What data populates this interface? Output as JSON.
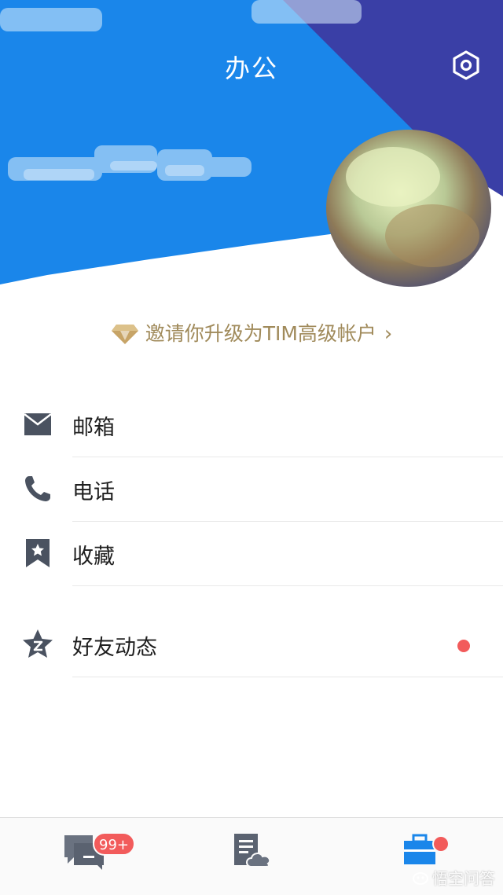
{
  "header": {
    "title": "办公",
    "settings_icon": "settings-hexagon-icon"
  },
  "invite": {
    "text": "邀请你升级为TIM高级帐户",
    "chevron": "›",
    "color": "#a08a5a"
  },
  "menu": [
    {
      "label": "邮箱",
      "icon": "mail-icon"
    },
    {
      "label": "电话",
      "icon": "phone-icon"
    },
    {
      "label": "收藏",
      "icon": "bookmark-star-icon"
    },
    {
      "label": "好友动态",
      "icon": "qzone-star-icon",
      "has_notification": true
    }
  ],
  "tabbar": {
    "tabs": [
      {
        "name": "messages",
        "icon": "chat-icon",
        "badge": "99+"
      },
      {
        "name": "documents",
        "icon": "doc-cloud-icon"
      },
      {
        "name": "office",
        "icon": "briefcase-icon",
        "active": true,
        "dot": true
      }
    ]
  },
  "colors": {
    "primary_blue": "#1a86ea",
    "dark_blue": "#3a3fa6",
    "accent_red": "#f25b5b",
    "active_tab": "#1a86ea"
  },
  "watermark": "悟空问答"
}
